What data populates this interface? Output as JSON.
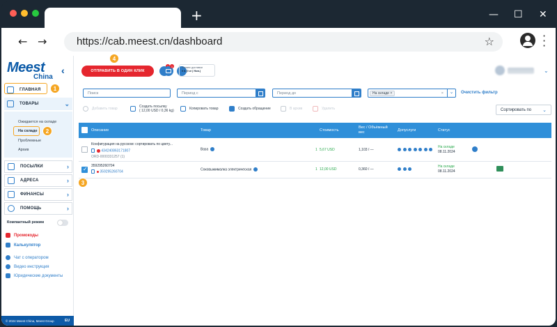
{
  "browser": {
    "url": "https://cab.meest.cn/dashboard",
    "new_tab": "+",
    "controls": {
      "minimize": "—",
      "maximize": "☐",
      "close": "✕"
    },
    "colors": {
      "dot_red": "#ff5f56",
      "dot_yellow": "#ffbd2e",
      "dot_green": "#27c93f"
    }
  },
  "logo": {
    "main": "Meest",
    "sub": "China"
  },
  "sidebar": {
    "collapse": "‹",
    "nav": [
      {
        "label": "ГЛАВНАЯ"
      },
      {
        "label": "ТОВАРЫ"
      },
      {
        "label": "ПОСЫЛКИ"
      },
      {
        "label": "АДРЕСА"
      },
      {
        "label": "ФИНАНСЫ"
      },
      {
        "label": "ПОМОЩЬ"
      }
    ],
    "sub": [
      "Ожидается на складе",
      "На складе",
      "Проблемные",
      "Архив"
    ],
    "compact_mode": "Компактный режим",
    "links": [
      "Промокоды",
      "Калькулятор",
      "Чат с оператором",
      "Видео инструкция",
      "Юридические документы"
    ],
    "footer": "© 2024 Meest China, Meest Group",
    "lang": "EU"
  },
  "markers": [
    "1",
    "2",
    "3",
    "4"
  ],
  "header": {
    "send_button": "ОТПРАВИТЬ В ОДИН КЛИК",
    "badge_count": "1",
    "balance_label": "Баланс доставки",
    "balance_value": "0 $ (0 кг | Нов.)"
  },
  "filters": {
    "search_placeholder": "Поиск",
    "period_from": "Период с",
    "period_to": "Период до",
    "status_tag": "На складе",
    "status_tag_remove": "×",
    "status_clear": "×",
    "clear_filter": "Очистить фильтр"
  },
  "toolbar": {
    "add_product": "Добавить товар",
    "create_parcel": "Создать посылку",
    "create_parcel_sub": "( 12,00 USD / 0,36 kg)",
    "copy_product": "Копировать товар",
    "create_request": "Создать обращение",
    "archive": "В архив",
    "delete": "Удалить",
    "sort": "Сортировать по",
    "sort_chevron": "⌄"
  },
  "table": {
    "headers": [
      "Описание",
      "Товар",
      "Стоимость",
      "Вес / Объёмный вес",
      "Допуслуги",
      "Статус"
    ],
    "rows": [
      {
        "desc": "Конфигурация на русском: сортировать по цвету...",
        "tracking": "434240863171807",
        "ord": "ORD-0000331257 (1)",
        "product": "Ваза",
        "qty": "1",
        "price": "5,67 USD",
        "weight": "1,103 / —",
        "status": "На складе",
        "date": "08.11.2024"
      },
      {
        "desc": "359295260704",
        "tracking": "359295260704",
        "ord": "",
        "product": "Соковыжималка электрическая",
        "qty": "1",
        "price": "12,00 USD",
        "weight": "0,360 / —",
        "status": "На складе",
        "date": "08.11.2024"
      }
    ]
  }
}
